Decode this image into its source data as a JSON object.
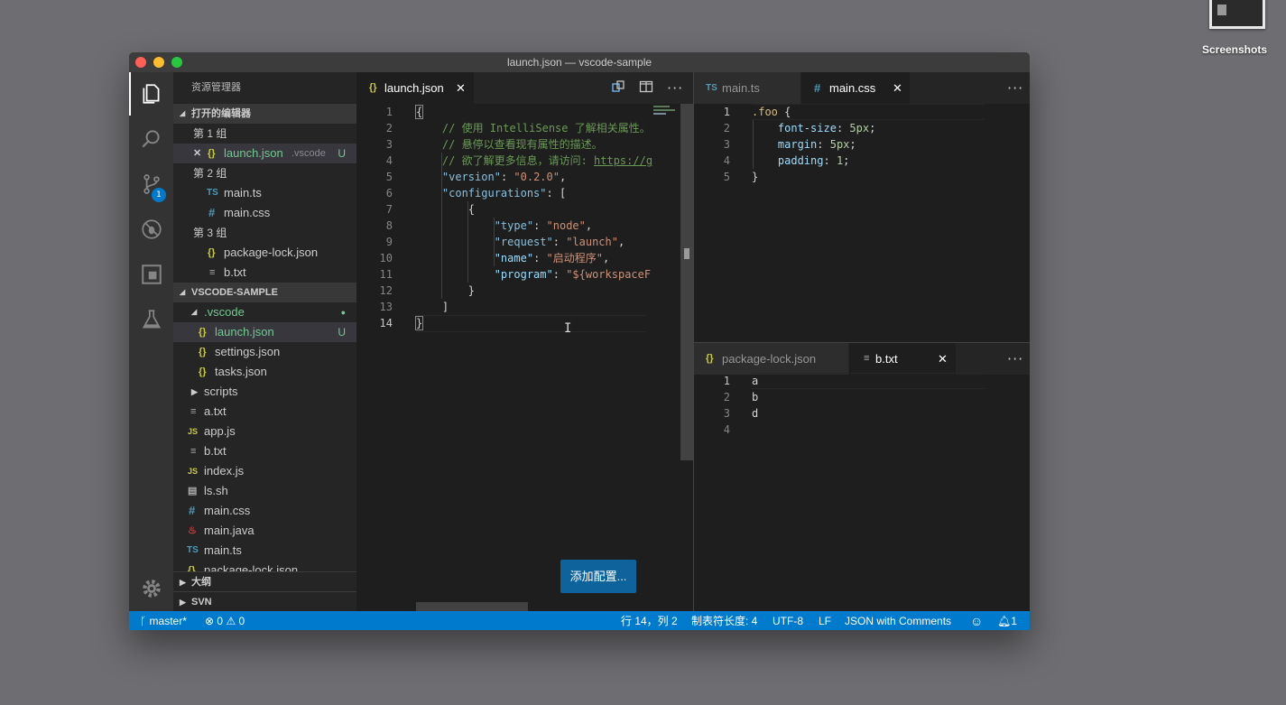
{
  "desktop": {
    "icon_label": "Screenshots"
  },
  "window": {
    "title": "launch.json — vscode-sample"
  },
  "activity_bar": {
    "scm_badge": "1"
  },
  "sidebar": {
    "title": "资源管理器",
    "open_editors": {
      "header": "打开的编辑器",
      "groups": [
        {
          "label": "第 1 组",
          "items": [
            {
              "icon": "{}",
              "name": "launch.json",
              "desc": ".vscode",
              "status": "U"
            }
          ]
        },
        {
          "label": "第 2 组",
          "items": [
            {
              "icon": "TS",
              "name": "main.ts"
            },
            {
              "icon": "#",
              "name": "main.css"
            }
          ]
        },
        {
          "label": "第 3 组",
          "items": [
            {
              "icon": "{}",
              "name": "package-lock.json"
            },
            {
              "icon": "≡",
              "name": "b.txt"
            }
          ]
        }
      ]
    },
    "workspace": {
      "header": "VSCODE-SAMPLE",
      "folder_vscode": ".vscode",
      "vscode_files": [
        {
          "icon": "{}",
          "name": "launch.json",
          "status": "U"
        },
        {
          "icon": "{}",
          "name": "settings.json"
        },
        {
          "icon": "{}",
          "name": "tasks.json"
        }
      ],
      "folder_scripts": "scripts",
      "files": [
        {
          "icon": "≡",
          "name": "a.txt",
          "kind": "txt"
        },
        {
          "icon": "JS",
          "name": "app.js",
          "kind": "js"
        },
        {
          "icon": "≡",
          "name": "b.txt",
          "kind": "txt"
        },
        {
          "icon": "JS",
          "name": "index.js",
          "kind": "js"
        },
        {
          "icon": "▤",
          "name": "ls.sh",
          "kind": "txt"
        },
        {
          "icon": "#",
          "name": "main.css",
          "kind": "css"
        },
        {
          "icon": "♨",
          "name": "main.java",
          "kind": "java"
        },
        {
          "icon": "TS",
          "name": "main.ts",
          "kind": "ts"
        },
        {
          "icon": "{}",
          "name": "package-lock.json",
          "kind": "json"
        }
      ]
    },
    "outline_header": "大纲",
    "svn_header": "SVN"
  },
  "editor_left": {
    "tab": {
      "icon": "{}",
      "name": "launch.json",
      "close": "✕"
    },
    "lines": [
      {
        "n": "1",
        "text": "{"
      },
      {
        "n": "2",
        "text": "    // 使用 IntelliSense 了解相关属性。"
      },
      {
        "n": "3",
        "text": "    // 悬停以查看现有属性的描述。"
      },
      {
        "n": "4",
        "text": "    // 欲了解更多信息，请访问: ",
        "link": "https://g"
      },
      {
        "n": "5",
        "key": "\"version\"",
        "val": "\"0.2.0\""
      },
      {
        "n": "6",
        "key": "\"configurations\"",
        "val": "["
      },
      {
        "n": "7",
        "text": "        {"
      },
      {
        "n": "8",
        "key": "\"type\"",
        "val": "\"node\""
      },
      {
        "n": "9",
        "key": "\"request\"",
        "val": "\"launch\""
      },
      {
        "n": "10",
        "key": "\"name\"",
        "val": "\"启动程序\""
      },
      {
        "n": "11",
        "key": "\"program\"",
        "val": "\"${workspaceF"
      },
      {
        "n": "12",
        "text": "        }"
      },
      {
        "n": "13",
        "text": "    ]"
      },
      {
        "n": "14",
        "text": "}"
      }
    ],
    "add_config_button": "添加配置..."
  },
  "editor_top_right": {
    "tabs": [
      {
        "icon": "TS",
        "name": "main.ts"
      },
      {
        "icon": "#",
        "name": "main.css",
        "close": "✕"
      }
    ],
    "lines": [
      {
        "n": "1",
        "selector": ".foo",
        "rest": " {"
      },
      {
        "n": "2",
        "prop": "font-size",
        "value": "5px"
      },
      {
        "n": "3",
        "prop": "margin",
        "value": "5px"
      },
      {
        "n": "4",
        "prop": "padding",
        "value": "1"
      },
      {
        "n": "5",
        "text": "}"
      }
    ]
  },
  "editor_bottom_right": {
    "tabs": [
      {
        "icon": "{}",
        "name": "package-lock.json"
      },
      {
        "icon": "≡",
        "name": "b.txt",
        "close": "✕"
      }
    ],
    "lines": [
      {
        "n": "1",
        "text": "a"
      },
      {
        "n": "2",
        "text": "b"
      },
      {
        "n": "3",
        "text": "d"
      },
      {
        "n": "4",
        "text": ""
      }
    ]
  },
  "status_bar": {
    "branch": "master*",
    "errors": "0",
    "warnings": "0",
    "position": "行 14，列 2",
    "tab_size": "制表符长度: 4",
    "encoding": "UTF-8",
    "eol": "LF",
    "language": "JSON with Comments",
    "notifications": "1"
  },
  "colors": {
    "accent": "#007acc",
    "button": "#0e639c",
    "activity": "#333333",
    "sidebar": "#252526",
    "editor": "#1e1e1e"
  }
}
